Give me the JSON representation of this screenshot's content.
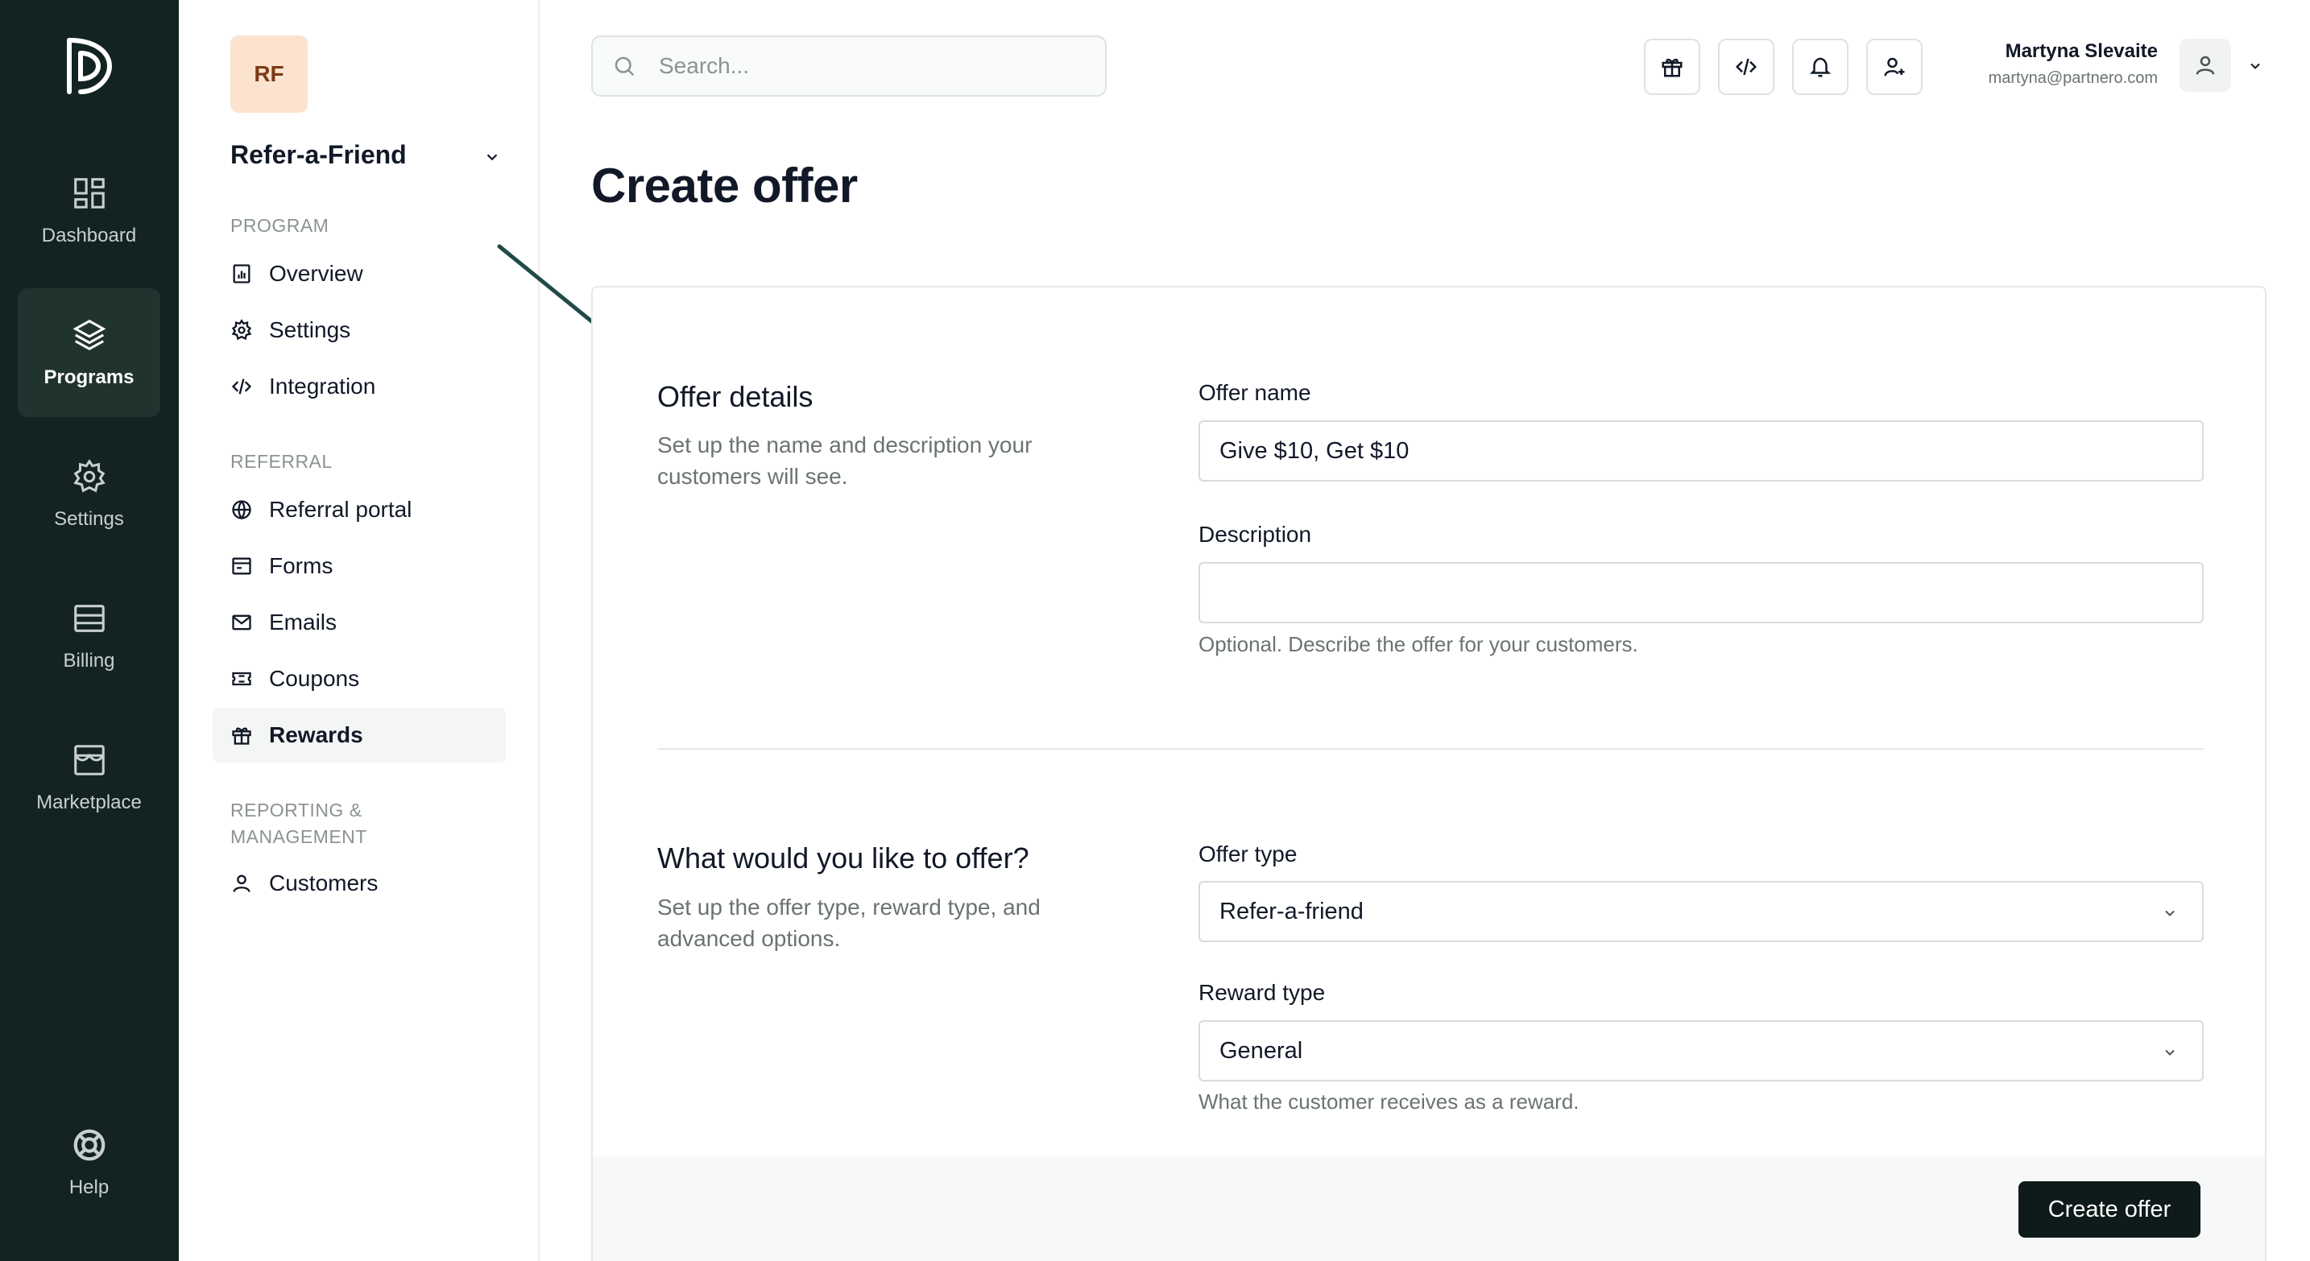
{
  "rail": {
    "items": [
      {
        "label": "Dashboard",
        "icon": "dashboard-icon"
      },
      {
        "label": "Programs",
        "icon": "layers-icon"
      },
      {
        "label": "Settings",
        "icon": "gear-icon"
      },
      {
        "label": "Billing",
        "icon": "billing-icon"
      },
      {
        "label": "Marketplace",
        "icon": "store-icon"
      }
    ],
    "help_label": "Help"
  },
  "sidebar": {
    "avatar_initials": "RF",
    "program_name": "Refer-a-Friend",
    "sections": {
      "program": "PROGRAM",
      "referral": "REFERRAL",
      "reporting": "REPORTING & MANAGEMENT"
    },
    "items": {
      "overview": "Overview",
      "settings": "Settings",
      "integration": "Integration",
      "referral_portal": "Referral portal",
      "forms": "Forms",
      "emails": "Emails",
      "coupons": "Coupons",
      "rewards": "Rewards",
      "customers": "Customers"
    },
    "active_item": "Rewards"
  },
  "topbar": {
    "search_placeholder": "Search...",
    "user_name": "Martyna Slevaite",
    "user_email": "martyna@partnero.com"
  },
  "page": {
    "title": "Create offer",
    "offer_details": {
      "title": "Offer details",
      "description": "Set up the name and description your customers will see.",
      "offer_name_label": "Offer name",
      "offer_name_value": "Give $10, Get $10",
      "description_label": "Description",
      "description_value": "",
      "description_hint": "Optional. Describe the offer for your customers."
    },
    "offer_what": {
      "title": "What would you like to offer?",
      "description": "Set up the offer type, reward type, and advanced options.",
      "offer_type_label": "Offer type",
      "offer_type_value": "Refer-a-friend",
      "reward_type_label": "Reward type",
      "reward_type_value": "General",
      "reward_type_hint": "What the customer receives as a reward."
    },
    "submit_label": "Create offer"
  },
  "colors": {
    "rail_bg": "#122321",
    "rail_active": "#21332f",
    "avatar_bg": "#fbe3cf",
    "primary_button": "#0f1b1a",
    "arrow": "#1f4a48"
  }
}
